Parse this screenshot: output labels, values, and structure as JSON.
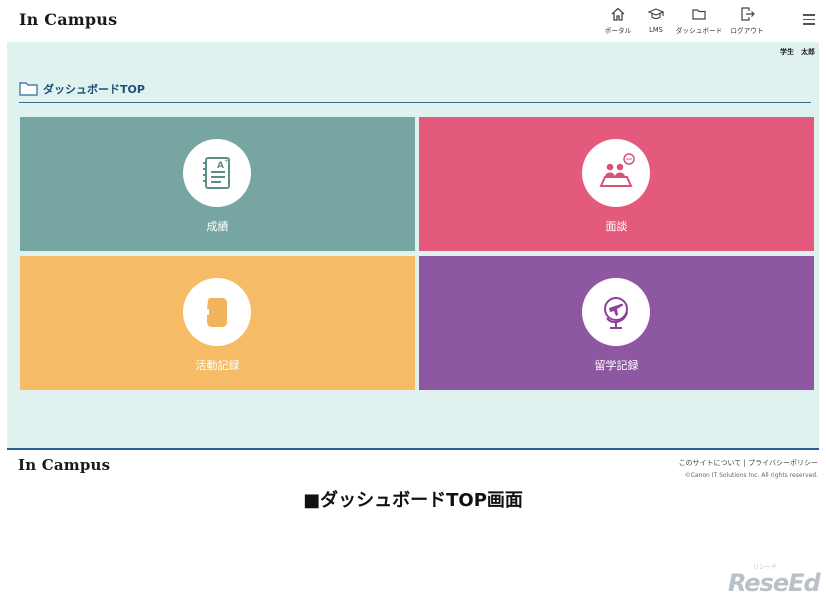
{
  "brand": {
    "logo": "In Campus"
  },
  "nav": [
    {
      "label": "ポータル",
      "icon": "home-icon"
    },
    {
      "label": "LMS",
      "icon": "graduation-cap-icon"
    },
    {
      "label": "ダッシュボード",
      "icon": "folder-icon"
    },
    {
      "label": "ログアウト",
      "icon": "logout-icon"
    }
  ],
  "user": {
    "name": "学生　太郎"
  },
  "page": {
    "title": "ダッシュボードTOP"
  },
  "tiles": [
    {
      "label": "成績",
      "icon": "report-card-icon",
      "color": "#77a5a1"
    },
    {
      "label": "面談",
      "icon": "meeting-icon",
      "color": "#e45a7c"
    },
    {
      "label": "活動記録",
      "icon": "sd-card-icon",
      "color": "#f5bb67"
    },
    {
      "label": "留学記録",
      "icon": "globe-plane-icon",
      "color": "#8d57a1"
    }
  ],
  "footer": {
    "logo": "In Campus",
    "link_about": "このサイトについて",
    "separator": "|",
    "link_privacy": "プライバシーポリシー",
    "copyright": "©Canon IT Solutions Inc. All rights reserved."
  },
  "caption": "■ダッシュボードTOP画面",
  "watermark": {
    "main": "ReseEd",
    "kana": "リシード"
  }
}
